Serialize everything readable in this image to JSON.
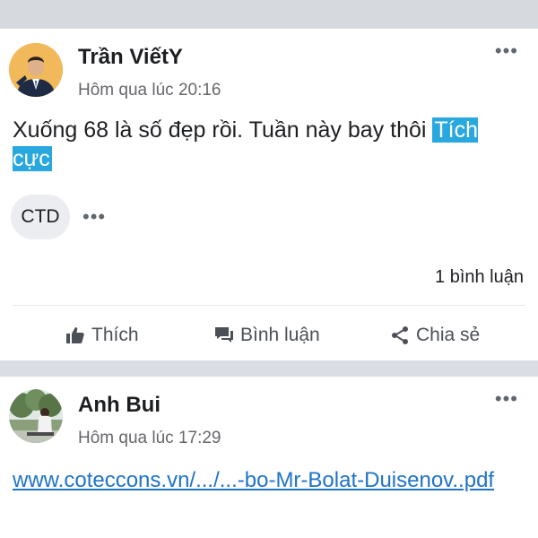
{
  "posts": [
    {
      "author": "Trần ViếtY",
      "time": "Hôm qua lúc 20:16",
      "content_text": "Xuống 68 là số đẹp rồi. Tuần này bay thôi ",
      "highlight": "Tích cực",
      "tag": "CTD",
      "comments": "1 bình luận",
      "icons": {
        "avatar": "person-in-suit",
        "more": "more-horizontal-icon"
      }
    },
    {
      "author": "Anh Bui",
      "time": "Hôm qua lúc 17:29",
      "link": "www.coteccons.vn/.../...-bo-Mr-Bolat-Duisenov..pdf",
      "icons": {
        "avatar": "person-outdoors-with-trees",
        "more": "more-horizontal-icon"
      }
    }
  ],
  "actions": {
    "like": "Thích",
    "comment": "Bình luận",
    "share": "Chia sẻ"
  },
  "colors": {
    "highlight_bg": "#29a8e0",
    "link": "#1f73c9",
    "divider": "#dadde1",
    "secondary_text": "#65676b"
  }
}
